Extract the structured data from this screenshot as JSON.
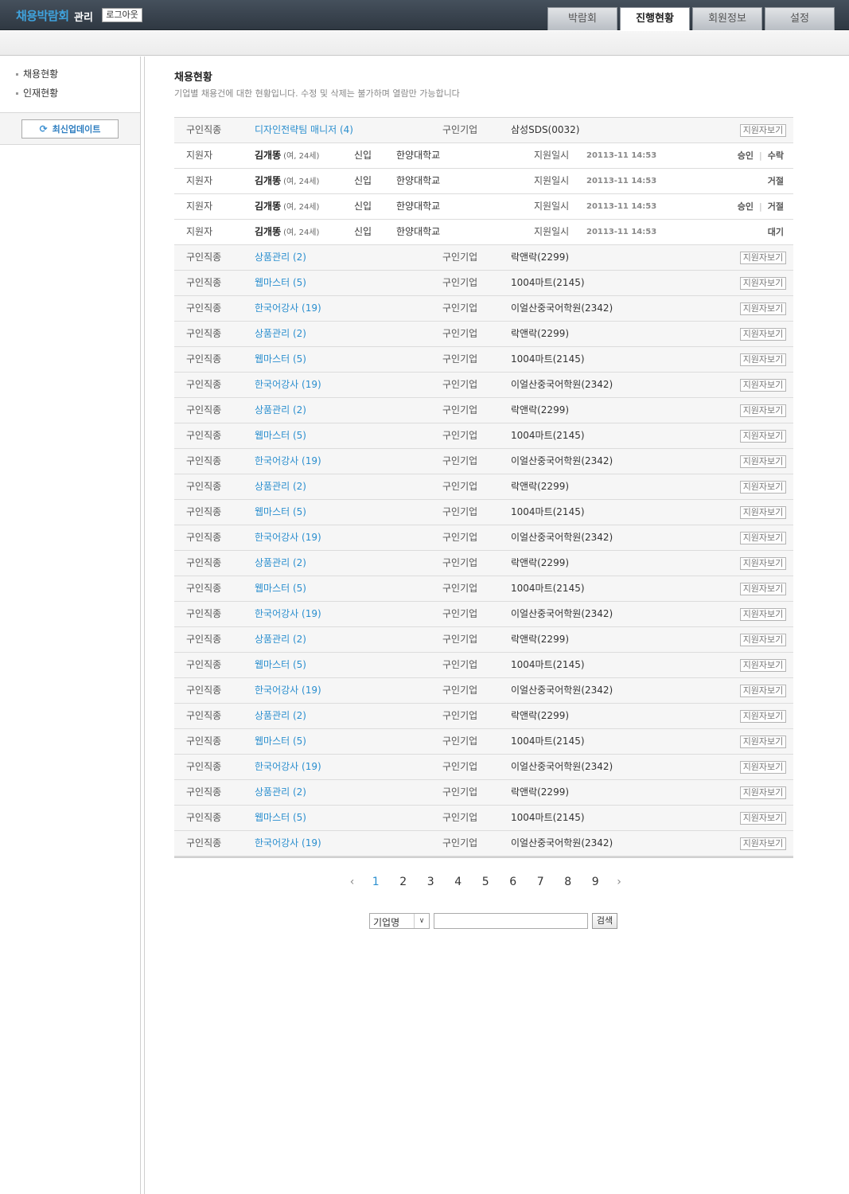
{
  "header": {
    "brand": "채용박람회",
    "brand_sub": "관리",
    "logout_label": "로그아웃",
    "tabs": [
      {
        "label": "박람회",
        "active": false
      },
      {
        "label": "진행현황",
        "active": true
      },
      {
        "label": "회원정보",
        "active": false
      },
      {
        "label": "설정",
        "active": false
      }
    ]
  },
  "sidebar": {
    "items": [
      {
        "label": "채용현황"
      },
      {
        "label": "인재현황"
      }
    ],
    "update_label": "최신업데이트",
    "update_icon": "refresh-icon"
  },
  "main": {
    "title": "채용현황",
    "description": "기업별 채용건에 대한 현황입니다. 수정 및 삭제는 불가하며 열람만 가능합니다"
  },
  "labels": {
    "job": "구인직종",
    "company": "구인기업",
    "view": "지원자보기",
    "applicant": "지원자",
    "apply_date": "지원일시"
  },
  "rows": [
    {
      "type": "job",
      "job": "디자인전략팀 매니저 (4)",
      "company": "삼성SDS(0032)"
    },
    {
      "type": "app",
      "name": "김개똥",
      "info": "(여, 24세)",
      "kind": "신입",
      "school": "한양대학교",
      "date": "20113-11 14:53",
      "status": [
        "승인",
        "수락"
      ]
    },
    {
      "type": "app",
      "name": "김개똥",
      "info": "(여, 24세)",
      "kind": "신입",
      "school": "한양대학교",
      "date": "20113-11 14:53",
      "status": [
        "거절"
      ]
    },
    {
      "type": "app",
      "name": "김개똥",
      "info": "(여, 24세)",
      "kind": "신입",
      "school": "한양대학교",
      "date": "20113-11 14:53",
      "status": [
        "승인",
        "거절"
      ]
    },
    {
      "type": "app",
      "name": "김개똥",
      "info": "(여, 24세)",
      "kind": "신입",
      "school": "한양대학교",
      "date": "20113-11 14:53",
      "status": [
        "대기"
      ]
    },
    {
      "type": "job",
      "job": "상품관리 (2)",
      "company": "락앤락(2299)"
    },
    {
      "type": "job",
      "job": "웹마스터 (5)",
      "company": "1004마트(2145)"
    },
    {
      "type": "job",
      "job": "한국어강사 (19)",
      "company": "이얼산중국어학원(2342)"
    },
    {
      "type": "job",
      "job": "상품관리 (2)",
      "company": "락앤락(2299)"
    },
    {
      "type": "job",
      "job": "웹마스터 (5)",
      "company": "1004마트(2145)"
    },
    {
      "type": "job",
      "job": "한국어강사 (19)",
      "company": "이얼산중국어학원(2342)"
    },
    {
      "type": "job",
      "job": "상품관리 (2)",
      "company": "락앤락(2299)"
    },
    {
      "type": "job",
      "job": "웹마스터 (5)",
      "company": "1004마트(2145)"
    },
    {
      "type": "job",
      "job": "한국어강사 (19)",
      "company": "이얼산중국어학원(2342)"
    },
    {
      "type": "job",
      "job": "상품관리 (2)",
      "company": "락앤락(2299)"
    },
    {
      "type": "job",
      "job": "웹마스터 (5)",
      "company": "1004마트(2145)"
    },
    {
      "type": "job",
      "job": "한국어강사 (19)",
      "company": "이얼산중국어학원(2342)"
    },
    {
      "type": "job",
      "job": "상품관리 (2)",
      "company": "락앤락(2299)"
    },
    {
      "type": "job",
      "job": "웹마스터 (5)",
      "company": "1004마트(2145)"
    },
    {
      "type": "job",
      "job": "한국어강사 (19)",
      "company": "이얼산중국어학원(2342)"
    },
    {
      "type": "job",
      "job": "상품관리 (2)",
      "company": "락앤락(2299)"
    },
    {
      "type": "job",
      "job": "웹마스터 (5)",
      "company": "1004마트(2145)"
    },
    {
      "type": "job",
      "job": "한국어강사 (19)",
      "company": "이얼산중국어학원(2342)"
    },
    {
      "type": "job",
      "job": "상품관리 (2)",
      "company": "락앤락(2299)"
    },
    {
      "type": "job",
      "job": "웹마스터 (5)",
      "company": "1004마트(2145)"
    },
    {
      "type": "job",
      "job": "한국어강사 (19)",
      "company": "이얼산중국어학원(2342)"
    },
    {
      "type": "job",
      "job": "상품관리 (2)",
      "company": "락앤락(2299)"
    },
    {
      "type": "job",
      "job": "웹마스터 (5)",
      "company": "1004마트(2145)"
    },
    {
      "type": "job",
      "job": "한국어강사 (19)",
      "company": "이얼산중국어학원(2342)"
    }
  ],
  "pagination": {
    "prev": "‹",
    "next": "›",
    "pages": [
      "1",
      "2",
      "3",
      "4",
      "5",
      "6",
      "7",
      "8",
      "9"
    ],
    "current": "1"
  },
  "search": {
    "select_value": "기업명",
    "input_value": "",
    "button_label": "검색"
  },
  "colors": {
    "accent": "#2b8fcf",
    "topbar": "#3a444f"
  }
}
